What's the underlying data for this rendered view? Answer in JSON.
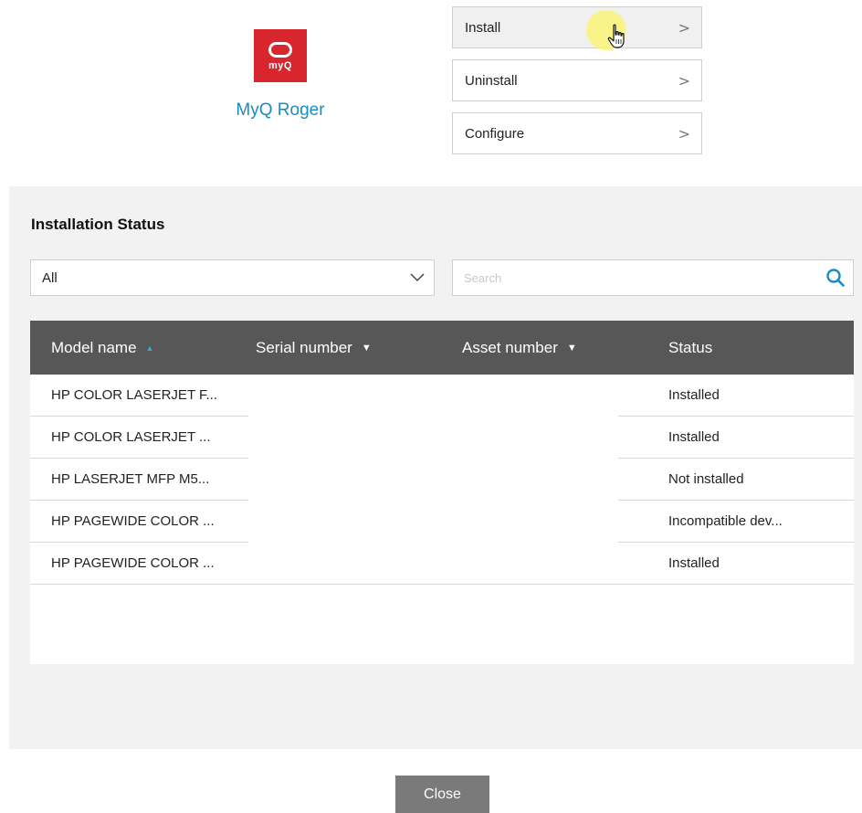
{
  "app": {
    "logo_text": "myQ",
    "name": "MyQ Roger",
    "brand_color": "#d7262e",
    "accent_color": "#1a8bc2"
  },
  "actions": [
    {
      "label": "Install",
      "icon": "chevron-right-icon"
    },
    {
      "label": "Uninstall",
      "icon": "chevron-right-icon"
    },
    {
      "label": "Configure",
      "icon": "chevron-right-icon"
    }
  ],
  "installation_status": {
    "title": "Installation Status",
    "filter": {
      "selected": "All"
    },
    "search": {
      "placeholder": "Search",
      "value": ""
    },
    "columns": [
      {
        "label": "Model name",
        "sort": "ascending"
      },
      {
        "label": "Serial number",
        "sort": "dropdown"
      },
      {
        "label": "Asset number",
        "sort": "dropdown"
      },
      {
        "label": "Status",
        "sort": ""
      }
    ],
    "rows": [
      {
        "model": "HP COLOR LASERJET F...",
        "serial": "",
        "asset": "",
        "status": "Installed"
      },
      {
        "model": "HP COLOR LASERJET ...",
        "serial": "",
        "asset": "",
        "status": "Installed"
      },
      {
        "model": "HP LASERJET MFP M5...",
        "serial": "",
        "asset": "",
        "status": "Not installed"
      },
      {
        "model": "HP PAGEWIDE COLOR ...",
        "serial": "",
        "asset": "",
        "status": "Incompatible dev..."
      },
      {
        "model": "HP PAGEWIDE COLOR ...",
        "serial": "",
        "asset": "",
        "status": "Installed"
      }
    ]
  },
  "footer": {
    "close_label": "Close"
  }
}
